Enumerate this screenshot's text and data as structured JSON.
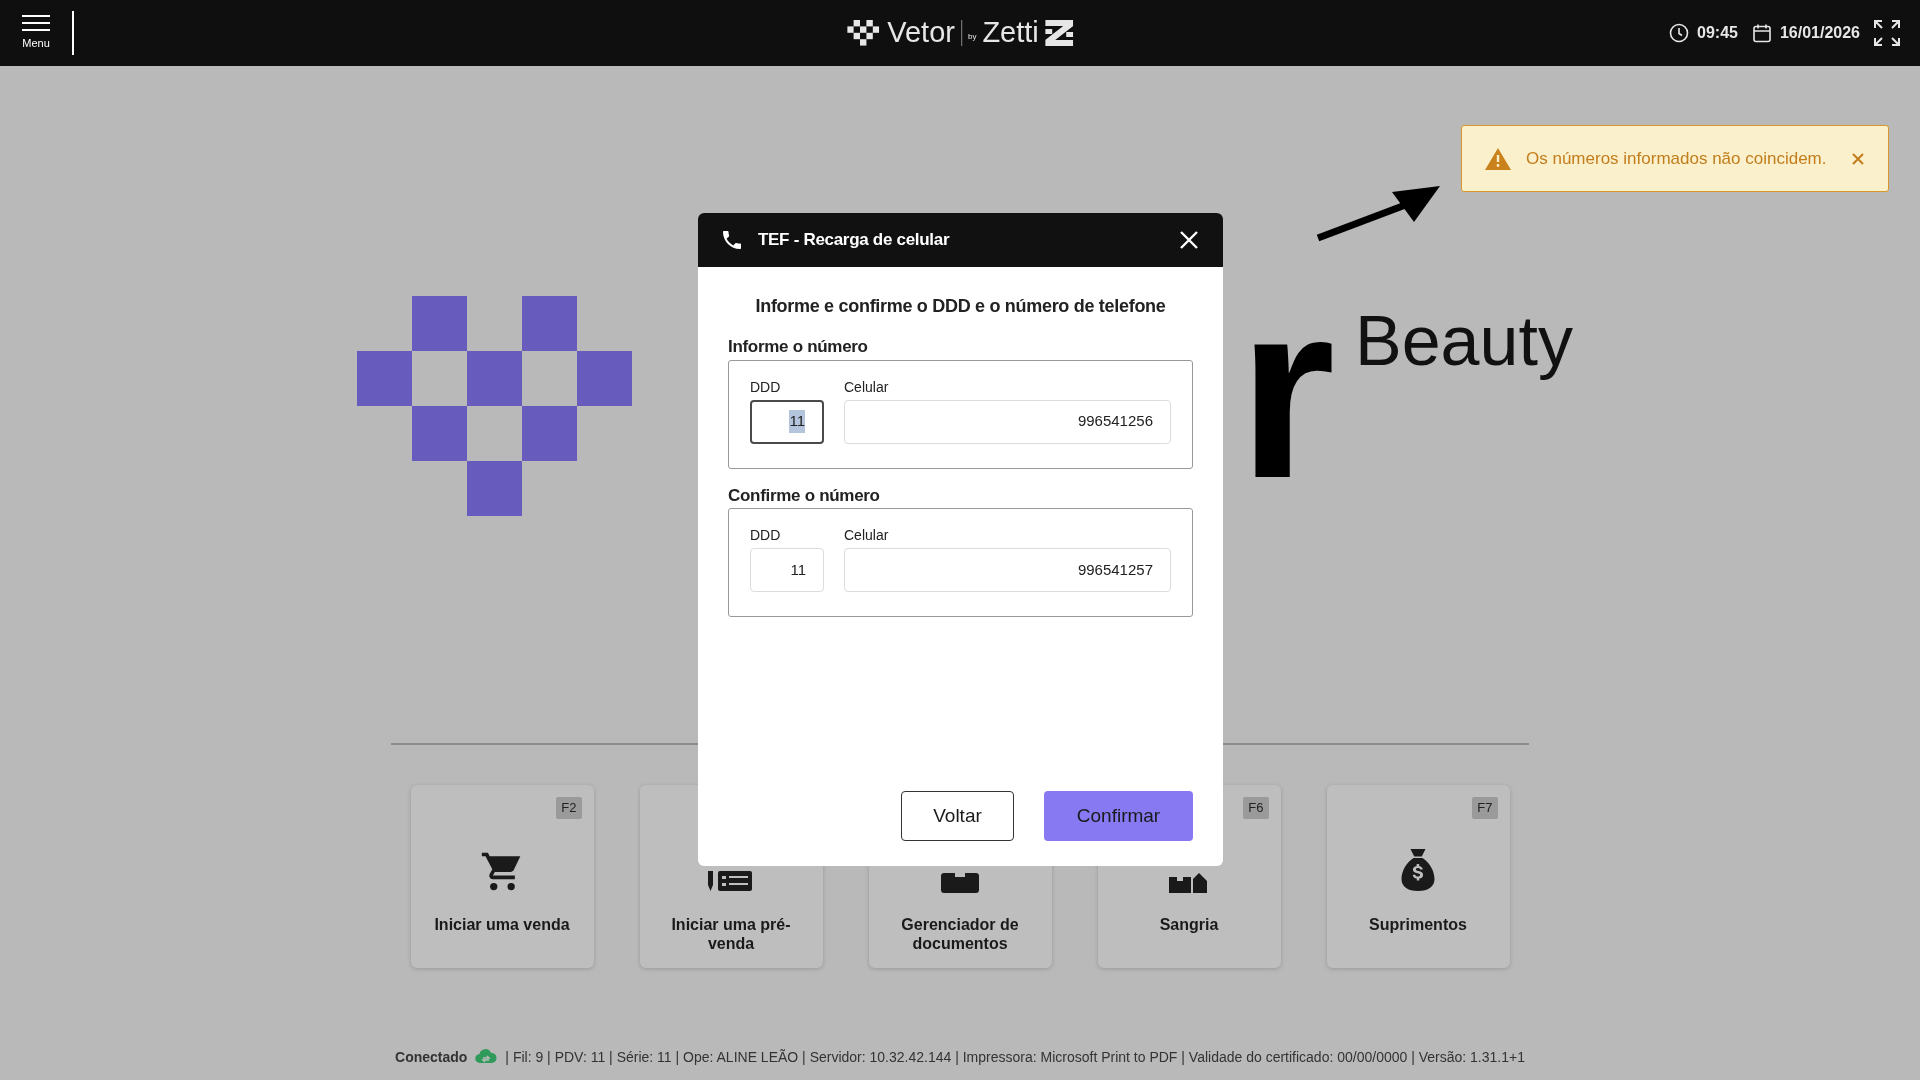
{
  "top_bar": {
    "menu_label": "Menu",
    "brand": {
      "name": "Vetor",
      "by": "by",
      "partner": "Zetti"
    },
    "time": "09:45",
    "date": "16/01/2026"
  },
  "hero": {
    "wordmark_visible": "r",
    "tagline": "Beauty"
  },
  "toast": {
    "kind": "warning",
    "message": "Os números informados não coincidem."
  },
  "dialog": {
    "title": "TEF - Recarga de celular",
    "instruction": "Informe e confirme o DDD e o número de telefone",
    "sections": [
      {
        "title": "Informe o número",
        "ddd": {
          "label": "DDD",
          "value": "11",
          "focused": true
        },
        "phone": {
          "label": "Celular",
          "value": "996541256",
          "focused": false
        }
      },
      {
        "title": "Confirme o número",
        "ddd": {
          "label": "DDD",
          "value": "11",
          "focused": false
        },
        "phone": {
          "label": "Celular",
          "value": "996541257",
          "focused": false
        }
      }
    ],
    "buttons": [
      {
        "label": "Voltar",
        "kind": "secondary"
      },
      {
        "label": "Confirmar",
        "kind": "primary"
      }
    ]
  },
  "shortcuts": [
    {
      "label": "Iniciar uma venda",
      "key": "F2",
      "kind": "cart"
    },
    {
      "label": "Iniciar uma pré-venda",
      "kind": "list"
    },
    {
      "label": "Gerenciador de documentos",
      "kind": "folder"
    },
    {
      "label": "Sangria",
      "key": "F6",
      "kind": "cash"
    },
    {
      "label": "Suprimentos",
      "key": "F7",
      "kind": "moneybag"
    }
  ],
  "status_bar": {
    "status": "Conectado",
    "details": "| Fil: 9 | PDV: 11 | Série: 11 | Ope: ALINE LEÃO | Servidor: 10.32.42.144 | Impressora: Microsoft Print to PDF | Validade do certificado: 00/00/0000 | Versão: 1.31.1+1"
  }
}
